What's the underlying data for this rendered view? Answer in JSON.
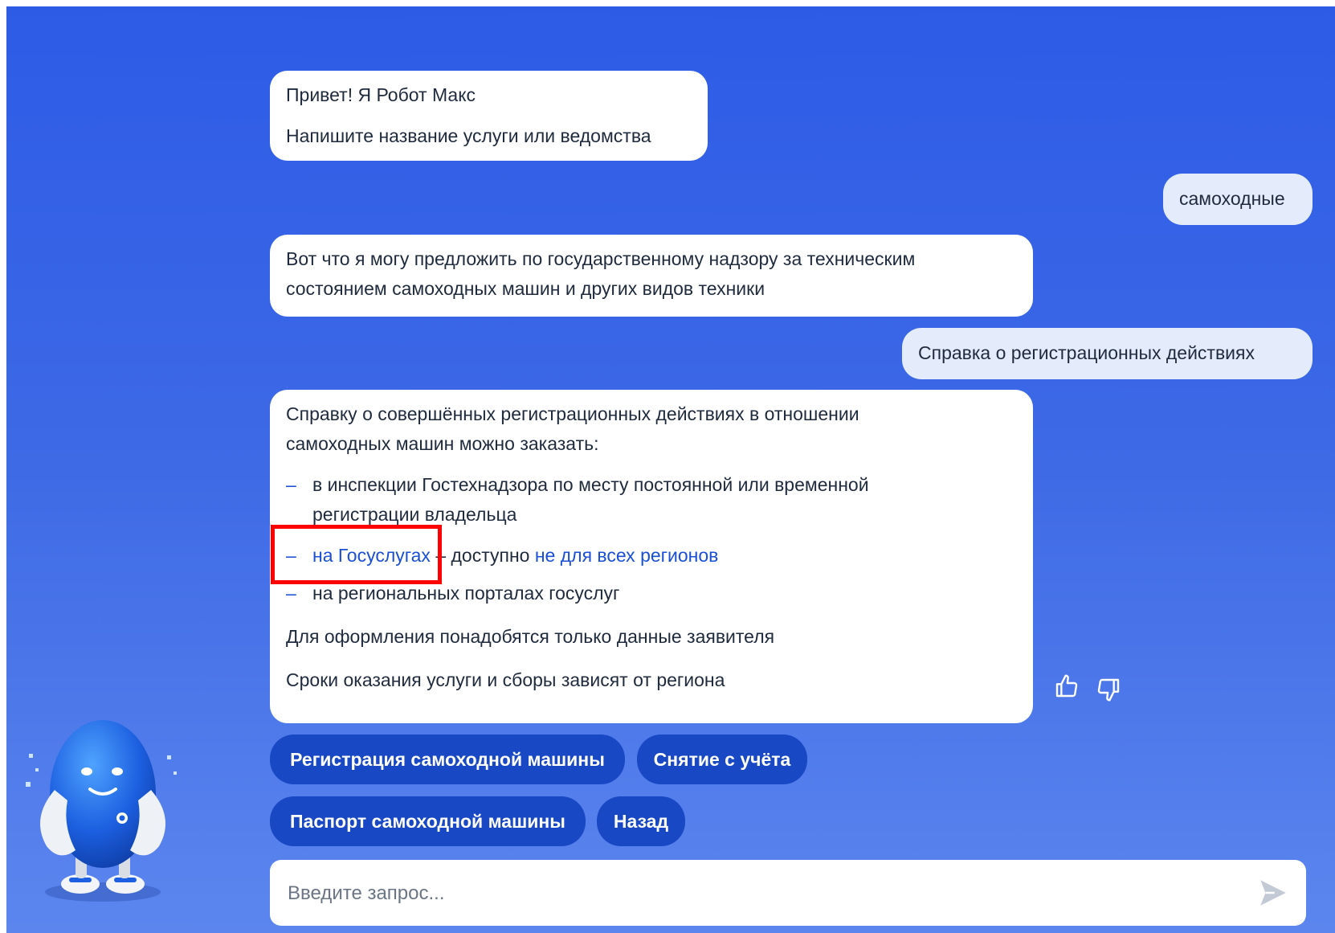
{
  "messages": {
    "greeting": {
      "line1": "Привет! Я Робот Макс",
      "line2": "Напишите название услуги или ведомства"
    },
    "user1": "самоходные",
    "bot2": "Вот что я могу предложить по государственному надзору за техническим состоянием самоходных машин и других видов техники",
    "user2": "Справка о регистрационных действиях",
    "bot3": {
      "intro": "Справку о совершённых регистрационных действиях в отношении самоходных машин можно заказать:",
      "items": [
        {
          "text": "в инспекции Гостехнадзора по месту постоянной или временной регистрации владельца"
        },
        {
          "link": "на Госуслугах",
          "middle": " – доступно ",
          "link2": "не для всех регионов"
        },
        {
          "text": "на региональных порталах госуслуг"
        }
      ],
      "note1": "Для оформления понадобятся только данные заявителя",
      "note2": "Сроки оказания услуги и сборы зависят от региона"
    }
  },
  "quick_replies": [
    "Регистрация самоходной машины",
    "Снятие с учёта",
    "Паспорт самоходной машины",
    "Назад"
  ],
  "input": {
    "placeholder": "Введите запрос..."
  },
  "icons": {
    "like": "thumbs-up-icon",
    "dislike": "thumbs-down-icon",
    "send": "send-icon",
    "mascot": "robot-max-mascot"
  },
  "colors": {
    "background_top": "#2d5be6",
    "background_bottom": "#5c86ee",
    "chip": "#1948c4",
    "link": "#1a4fd6",
    "highlight": "#ff0000"
  }
}
